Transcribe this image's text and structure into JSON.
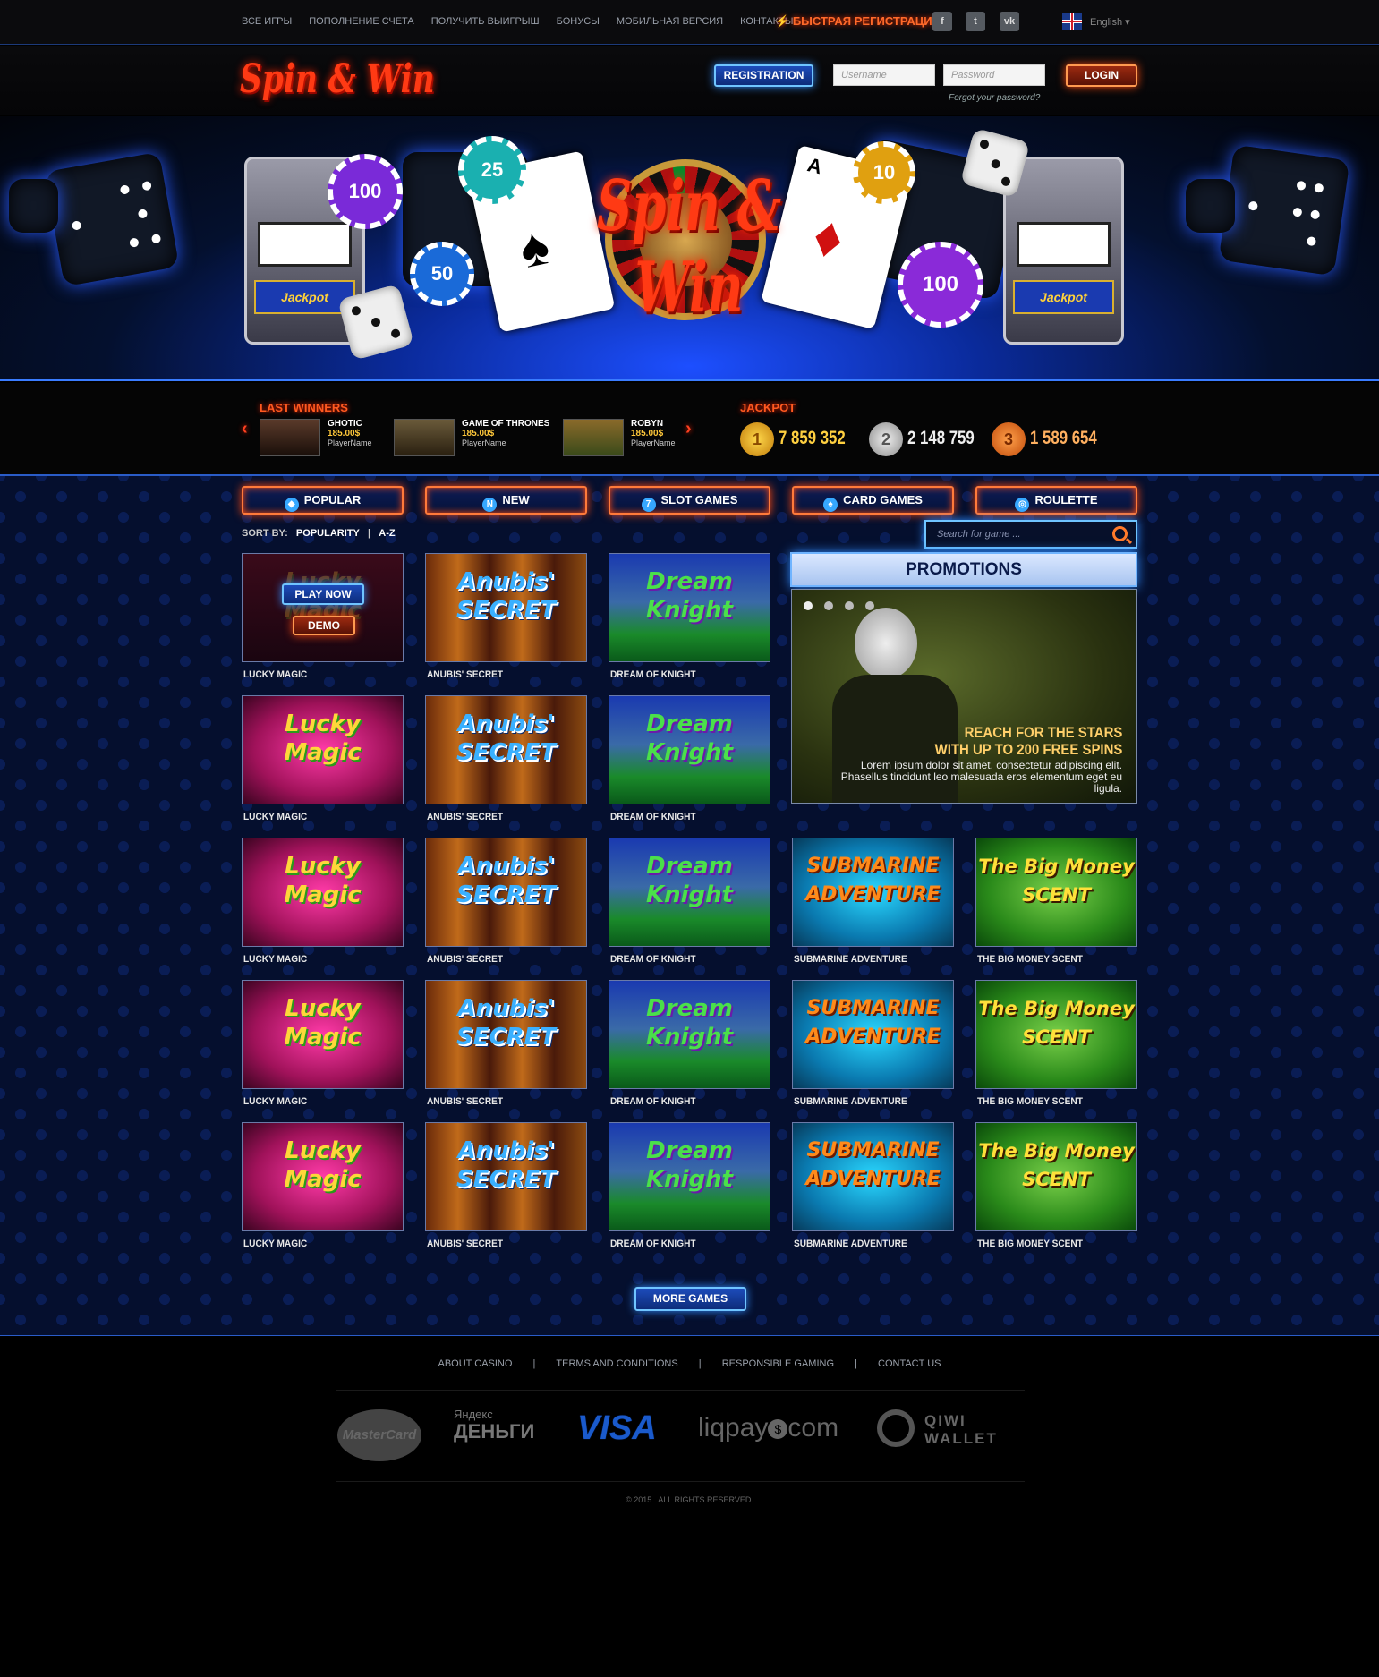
{
  "topbar": {
    "nav": [
      "ВСЕ ИГРЫ",
      "ПОПОЛНЕНИЕ СЧЕТА",
      "ПОЛУЧИТЬ ВЫИГРЫШ",
      "БОНУСЫ",
      "МОБИЛЬНАЯ ВЕРСИЯ",
      "КОНТАКТЫ"
    ],
    "fast_registration": "БЫСТРАЯ РЕГИСТРАЦИЯ",
    "social": [
      "f",
      "t",
      "vk"
    ],
    "language": "English"
  },
  "header": {
    "logo": "Spin & Win",
    "registration_label": "REGISTRATION",
    "username_placeholder": "Username",
    "password_placeholder": "Password",
    "login_label": "LOGIN",
    "forgot_password": "Forgot your password?"
  },
  "banner": {
    "title": "Spin & Win",
    "slot_label": "Jackpot",
    "chips": [
      "100",
      "25",
      "50",
      "10",
      "100"
    ]
  },
  "winners": {
    "label": "LAST WINNERS",
    "items": [
      {
        "game": "GHOTIC",
        "amount": "185.00$",
        "player": "PlayerName"
      },
      {
        "game": "GAME OF THRONES",
        "amount": "185.00$",
        "player": "PlayerName"
      },
      {
        "game": "ROBYN",
        "amount": "185.00$",
        "player": "PlayerName"
      }
    ]
  },
  "jackpot": {
    "label": "JACKPOT",
    "items": [
      {
        "rank": "1",
        "value": "7 859 352"
      },
      {
        "rank": "2",
        "value": "2 148 759"
      },
      {
        "rank": "3",
        "value": "1 589 654"
      }
    ]
  },
  "categories": [
    "POPULAR",
    "NEW",
    "SLOT GAMES",
    "CARD GAMES",
    "ROULETTE"
  ],
  "sort": {
    "label": "SORT BY:",
    "popularity": "POPULARITY",
    "separator": "|",
    "az": "A-Z"
  },
  "search": {
    "placeholder": "Search for game ..."
  },
  "hover": {
    "play_now": "PLAY NOW",
    "demo": "DEMO"
  },
  "games": {
    "lucky": {
      "title_1": "Lucky",
      "title_2": "Magic",
      "name": "LUCKY MAGIC"
    },
    "anubis": {
      "title_1": "Anubis'",
      "title_2": "SECRET",
      "name": "ANUBIS' SECRET"
    },
    "knight": {
      "title_1": "Dream",
      "title_2": "Knight",
      "name": "DREAM OF KNIGHT"
    },
    "sub": {
      "title_1": "SUBMARINE",
      "title_2": "ADVENTURE",
      "name": "SUBMARINE ADVENTURE"
    },
    "money": {
      "title_1": "The Big Money",
      "title_2": "SCENT",
      "name": "THE BIG MONEY SCENT"
    }
  },
  "promotions": {
    "title": "PROMOTIONS",
    "headline_1": "REACH FOR THE STARS",
    "headline_2": "WITH UP TO 200 FREE SPINS",
    "body": "Lorem ipsum dolor sit amet, consectetur adipiscing elit. Phasellus tincidunt leo malesuada eros elementum eget eu ligula."
  },
  "more_games": "MORE GAMES",
  "footer": {
    "links": [
      "ABOUT CASINO",
      "TERMS AND CONDITIONS",
      "RESPONSIBLE GAMING",
      "CONTACT US"
    ],
    "separator": "|",
    "payments": [
      "MasterCard",
      "Яндекс",
      "ДЕНЬГИ",
      "VISA",
      "liqpay",
      "com",
      "QIWI",
      "WALLET"
    ],
    "copyright": "© 2015 . ALL RIGHTS RESERVED."
  }
}
